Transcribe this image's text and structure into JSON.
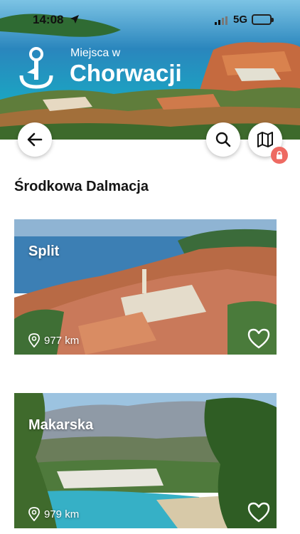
{
  "status_bar": {
    "time": "14:08",
    "network": "5G"
  },
  "header": {
    "pretitle": "Miejsca w",
    "title": "Chorwacji"
  },
  "toolbar": {
    "back_icon": "arrow-left-icon",
    "search_icon": "search-icon",
    "map_icon": "map-icon",
    "lock_icon": "lock-icon"
  },
  "section": {
    "title": "Środkowa Dalmacja"
  },
  "places": [
    {
      "name": "Split",
      "distance": "977 km"
    },
    {
      "name": "Makarska",
      "distance": "979 km"
    }
  ],
  "colors": {
    "accent_lock": "#ee6a62",
    "battery": "#f2c232"
  }
}
